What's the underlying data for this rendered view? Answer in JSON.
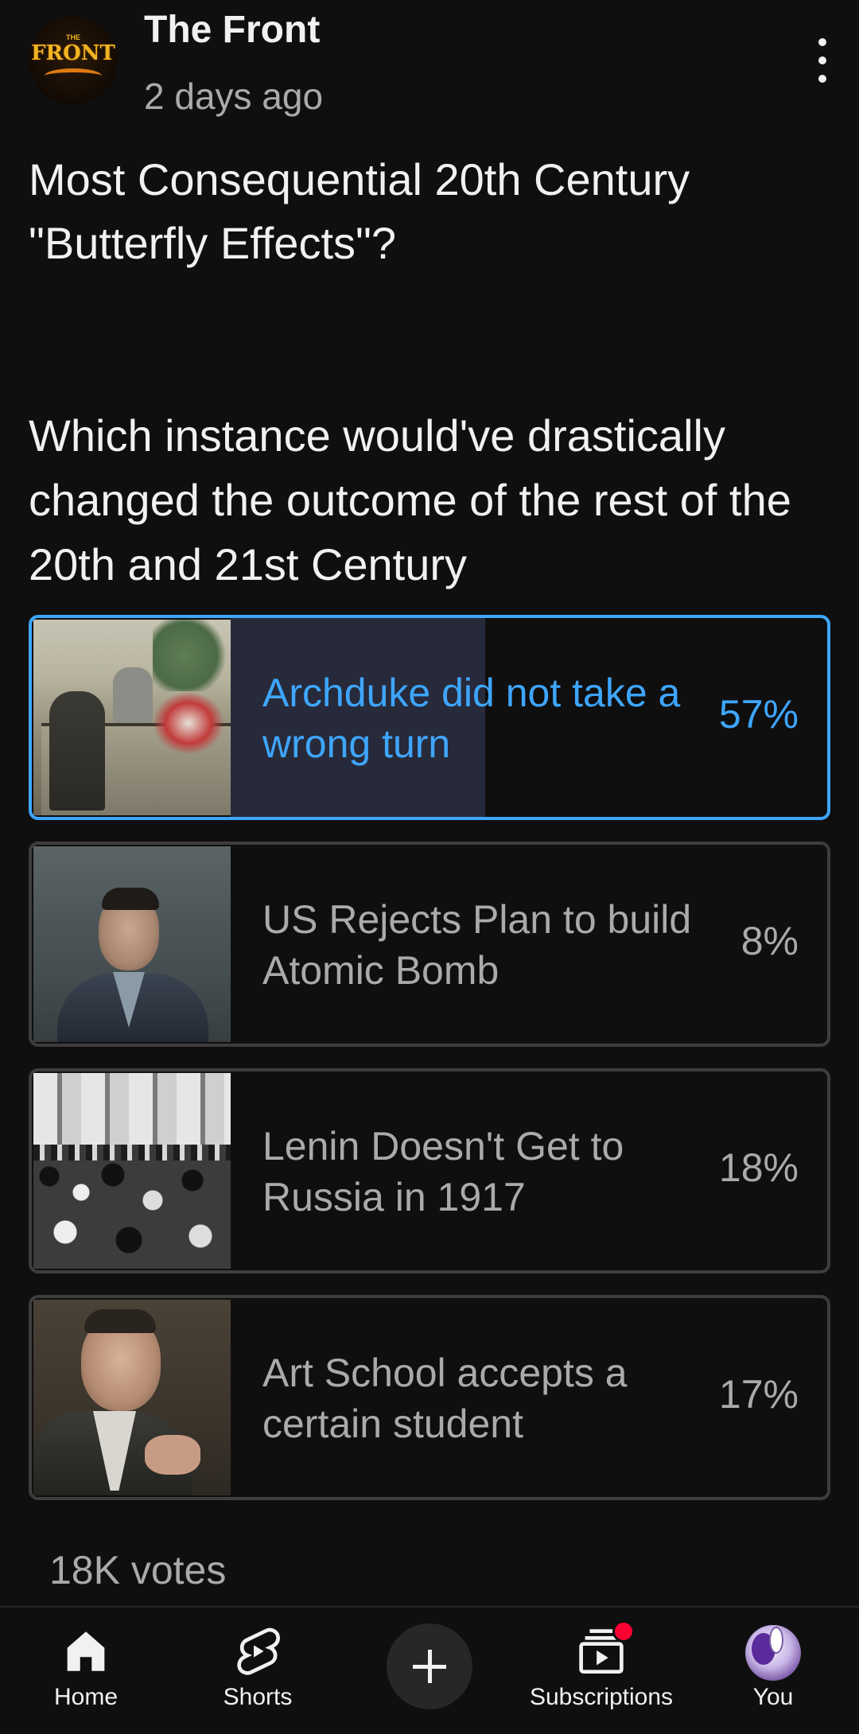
{
  "post": {
    "channel_name": "The Front",
    "avatar_text": "FRONT",
    "avatar_subtext": "THE",
    "time_ago": "2 days ago",
    "title": "Most Consequential 20th Century\n\"Butterfly Effects\"?",
    "body": "Which instance would've drastically changed the outcome of the rest of the 20th and 21st Century"
  },
  "poll": {
    "accent_color": "#3ea6ff",
    "options": [
      {
        "label": "Archduke did not take a wrong turn",
        "percent_text": "57%",
        "percent": 57,
        "selected": true
      },
      {
        "label": "US Rejects Plan to build Atomic Bomb",
        "percent_text": "8%",
        "percent": 8,
        "selected": false
      },
      {
        "label": "Lenin Doesn't Get to Russia in 1917",
        "percent_text": "18%",
        "percent": 18,
        "selected": false
      },
      {
        "label": "Art School accepts a certain student",
        "percent_text": "17%",
        "percent": 17,
        "selected": false
      }
    ],
    "vote_count": "18K votes"
  },
  "nav": {
    "home": "Home",
    "shorts": "Shorts",
    "create_icon": "plus-icon",
    "subscriptions": "Subscriptions",
    "you": "You",
    "notification_color": "#ff0033"
  }
}
